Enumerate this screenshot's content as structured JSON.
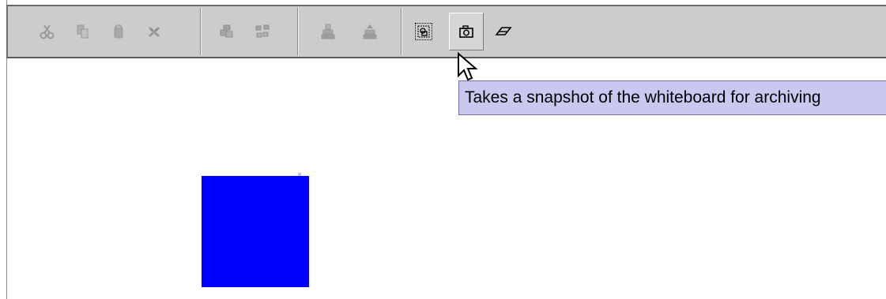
{
  "toolbar": {
    "groups": [
      [
        "cut-icon",
        "copy-icon",
        "paste-icon",
        "delete-icon"
      ],
      [
        "group-icon",
        "ungroup-icon"
      ],
      [
        "send-to-back-icon",
        "bring-to-front-icon"
      ],
      [
        "select-all-icon",
        "snapshot-camera-icon",
        "eraser-icon"
      ]
    ],
    "focused_button": "select-all-icon",
    "hovered_button": "snapshot-camera-icon"
  },
  "tooltip": {
    "text": "Takes a snapshot of the whiteboard for archiving"
  },
  "canvas": {
    "background": "#ffffff",
    "shapes": [
      {
        "type": "rectangle",
        "fill": "#0000ff"
      }
    ]
  },
  "colors": {
    "toolbar_bg": "#cccccc",
    "tooltip_bg": "#c8c8f0",
    "shape_fill": "#0000ff",
    "disabled_icon": "#9a9a9a"
  }
}
